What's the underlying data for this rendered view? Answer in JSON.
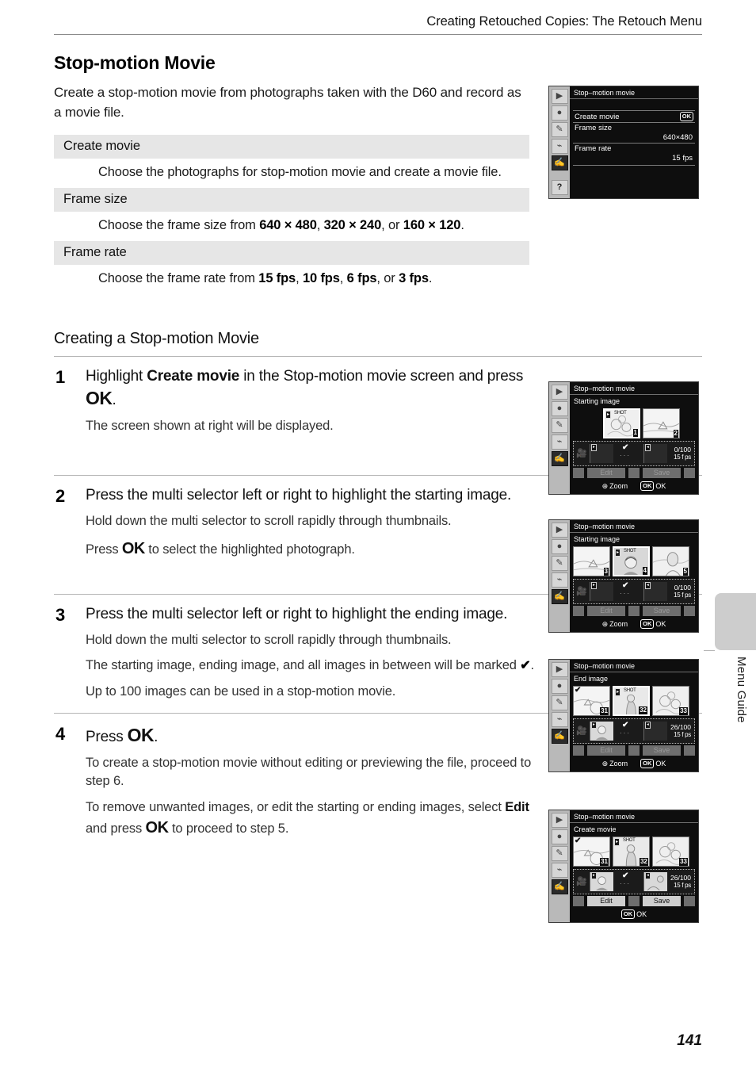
{
  "header": {
    "title": "Creating Retouched Copies: The Retouch Menu"
  },
  "section": {
    "title": "Stop-motion Movie",
    "intro": "Create a stop-motion movie from photographs taken with the D60 and record as a movie file."
  },
  "options_table": [
    {
      "name": "Create movie",
      "description": "Choose the photographs for stop-motion movie and create a movie file."
    },
    {
      "name": "Frame size",
      "desc_prefix": "Choose the frame size from ",
      "values": [
        "640 × 480",
        "320 × 240",
        "160 × 120"
      ],
      "sep1": ", ",
      "sep2": ", or ",
      "desc_suffix": "."
    },
    {
      "name": "Frame rate",
      "desc_prefix": "Choose the frame rate from ",
      "values": [
        "15 fps",
        "10 fps",
        "6 fps",
        "3 fps"
      ],
      "sep1": ", ",
      "sep2": ", or ",
      "desc_suffix": "."
    }
  ],
  "procedure": {
    "title": "Creating a Stop-motion Movie",
    "steps": [
      {
        "num": "1",
        "head_a": "Highlight ",
        "head_b": "Create movie",
        "head_c": " in the Stop-motion movie screen and press ",
        "head_ok": "OK",
        "head_d": ".",
        "notes": [
          "The screen shown at right will be displayed."
        ]
      },
      {
        "num": "2",
        "head_a": "Press the multi selector left or right to highlight the starting image.",
        "notes": [
          "Hold down the multi selector to scroll rapidly through thumbnails.",
          "Press OK to select the highlighted photograph."
        ],
        "note2_a": "Press ",
        "note2_ok": "OK",
        "note2_b": " to select the highlighted photograph."
      },
      {
        "num": "3",
        "head_a": "Press the multi selector left or right to highlight the ending image.",
        "notes": [
          "Hold down the multi selector to scroll rapidly through thumbnails.",
          "The starting image, ending image, and all images in between will be marked .",
          "Up to 100 images can be used in a stop-motion movie."
        ],
        "note2_a": "The starting image, ending image, and all images in between will be marked ",
        "note2_check": "✔",
        "note2_b": ".",
        "note3": "Up to 100 images can be used in a stop-motion movie."
      },
      {
        "num": "4",
        "head_a": "Press ",
        "head_ok": "OK",
        "head_d": ".",
        "note1": "To create a stop-motion movie without editing or previewing the file, proceed to step 6.",
        "note2_a": "To remove unwanted images, or edit the starting or ending images, select ",
        "note2_bold": "Edit",
        "note2_b": " and press ",
        "note2_ok": "OK",
        "note2_c": " to proceed to step 5."
      }
    ]
  },
  "lcd_rail": {
    "icons": [
      "play-icon",
      "camera-icon",
      "pencil-icon",
      "wrench-icon",
      "retouch-icon",
      "help-icon"
    ],
    "glyphs": [
      "▶",
      "●",
      "✎",
      "⑂",
      "✍",
      "?"
    ]
  },
  "lcd_menu": {
    "title": "Stop–motion movie",
    "rows": [
      {
        "label": "Create movie",
        "value": "",
        "badge": "OK"
      },
      {
        "label": "Frame size",
        "value": "640×480",
        "badge": ""
      },
      {
        "label": "Frame rate",
        "value": "15 fps",
        "badge": ""
      }
    ]
  },
  "lcd_step1": {
    "title": "Stop–motion movie",
    "subtitle": "Starting image",
    "thumbs": [
      {
        "num": "1",
        "highlight": true,
        "badge": "▸",
        "shot": "SHOT",
        "art": "flowers"
      },
      {
        "num": "2",
        "highlight": false,
        "badge": "",
        "shot": "",
        "art": "beach"
      }
    ],
    "count": "0/100",
    "fps": "15 f ps",
    "btn_edit": "Edit",
    "btn_save": "Save",
    "btn_state": "disabled",
    "foot_zoom": "Zoom",
    "foot_ok_badge": "OK",
    "foot_ok": "OK"
  },
  "lcd_step2": {
    "title": "Stop–motion movie",
    "subtitle": "Starting image",
    "thumbs": [
      {
        "num": "3",
        "highlight": false,
        "badge": "",
        "shot": "",
        "art": "beach"
      },
      {
        "num": "4",
        "highlight": true,
        "badge": "▸",
        "shot": "SHOT",
        "art": "portrait"
      },
      {
        "num": "5",
        "highlight": false,
        "badge": "",
        "shot": "",
        "art": "woman"
      }
    ],
    "count": "0/100",
    "fps": "15 f ps",
    "btn_edit": "Edit",
    "btn_save": "Save",
    "btn_state": "disabled",
    "foot_zoom": "Zoom",
    "foot_ok_badge": "OK",
    "foot_ok": "OK"
  },
  "lcd_step3": {
    "title": "Stop–motion movie",
    "subtitle": "End image",
    "thumbs": [
      {
        "num": "31",
        "highlight": false,
        "tick": "✔",
        "badge": "",
        "shot": "",
        "art": "beach"
      },
      {
        "num": "32",
        "highlight": true,
        "tick": "",
        "badge": "▸",
        "shot": "SHOT",
        "art": "figure"
      },
      {
        "num": "33",
        "highlight": false,
        "tick": "",
        "badge": "",
        "shot": "",
        "art": "flowers"
      }
    ],
    "count": "26/100",
    "fps": "15 f ps",
    "btn_edit": "Edit",
    "btn_save": "Save",
    "btn_state": "disabled",
    "foot_zoom": "Zoom",
    "foot_ok_badge": "OK",
    "foot_ok": "OK"
  },
  "lcd_step4": {
    "title": "Stop–motion movie",
    "subtitle": "Create movie",
    "thumbs": [
      {
        "num": "31",
        "highlight": false,
        "tick": "✔",
        "badge": "",
        "shot": "",
        "art": "beach"
      },
      {
        "num": "32",
        "highlight": false,
        "tick": "",
        "badge": "▸",
        "shot": "SHOT",
        "art": "figure"
      },
      {
        "num": "33",
        "highlight": false,
        "tick": "",
        "badge": "",
        "shot": "",
        "art": "flowers"
      }
    ],
    "count": "26/100",
    "fps": "15 f ps",
    "btn_edit": "Edit",
    "btn_save": "Save",
    "btn_state": "active",
    "foot_zoom": "",
    "foot_ok_badge": "OK",
    "foot_ok": "OK"
  },
  "side_tab": {
    "label": "Menu Guide"
  },
  "footer": {
    "page_number": "141"
  },
  "colors": {
    "table_header_bg": "#e6e6e6",
    "rule": "#b5b5b5",
    "lcd_bezel": "#c9c9c9",
    "lcd_screen": "#0e0e0e",
    "side_tab": "#cdcdcd"
  }
}
